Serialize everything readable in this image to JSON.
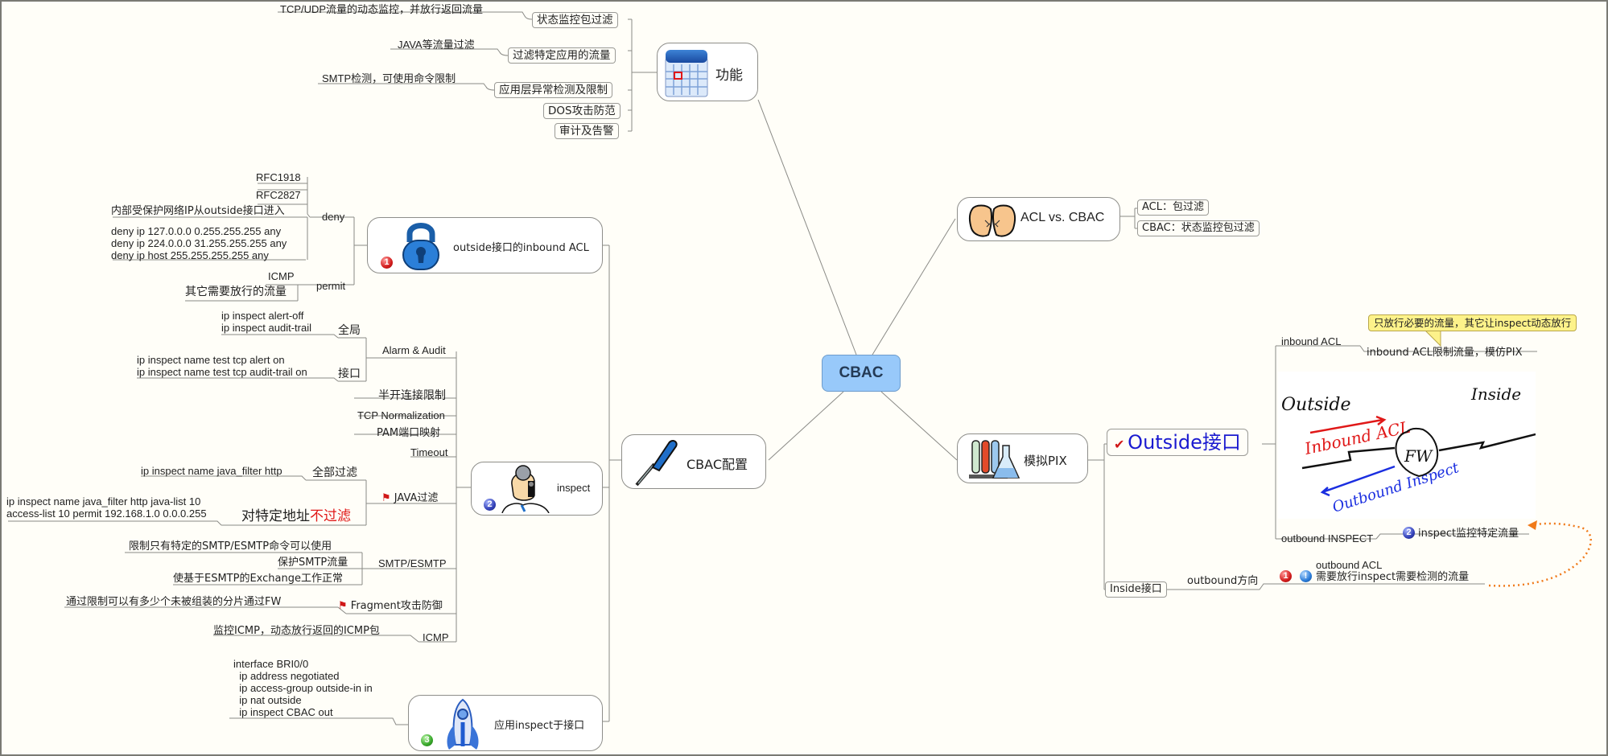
{
  "root": {
    "label": "CBAC"
  },
  "colors": {
    "root_fill": "#98c9fa",
    "accent_red": "#e01818",
    "outside_blue": "#1a1ad0",
    "dotted_arrow": "#f07a1a",
    "callout_fill": "#fdf28a"
  },
  "functions": {
    "label": "功能",
    "icon": "calendar-icon",
    "items": [
      {
        "label": "状态监控包过滤",
        "note": "TCP/UDP流量的动态监控，并放行返回流量"
      },
      {
        "label": "过滤特定应用的流量",
        "note": "JAVA等流量过滤"
      },
      {
        "label": "应用层异常检测及限制",
        "note": "SMTP检测，可使用命令限制"
      },
      {
        "label": "DOS攻击防范"
      },
      {
        "label": "审计及告警"
      }
    ]
  },
  "acl_vs_cbac": {
    "label": "ACL vs. CBAC",
    "icon": "fists-icon",
    "items": [
      "ACL：包过滤",
      "CBAC：状态监控包过滤"
    ]
  },
  "pix": {
    "label": "模拟PIX",
    "icon": "lab-flask-icon",
    "outside": {
      "label": "Outside接口",
      "inbound_acl": "inbound ACL",
      "inbound_acl_note": "inbound ACL限制流量，模仿PIX",
      "callout": "只放行必要的流量，其它让inspect动态放行",
      "drawing": {
        "outside": "Outside",
        "inside": "Inside",
        "inbound": "Inbound ACL",
        "fw": "FW",
        "outbound": "Outbound Inspect"
      },
      "outbound_inspect": "outbound INSPECT",
      "outbound_inspect_badge": "2",
      "outbound_inspect_note": "inspect监控特定流量"
    },
    "inside": {
      "label": "Inside接口",
      "direction": "outbound方向",
      "badge": "1",
      "note_title": "outbound ACL",
      "note_body": "需要放行inspect需要检测的流量"
    }
  },
  "config": {
    "label": "CBAC配置",
    "icon": "screwdriver-icon",
    "inbound_acl": {
      "label": "outside接口的inbound ACL",
      "badge": "1",
      "icon": "lock-icon",
      "deny": {
        "label": "deny",
        "items": [
          "RFC1918",
          "RFC2827",
          "内部受保护网络IP从outside接口进入"
        ],
        "commands": [
          "deny ip 127.0.0.0 0.255.255.255 any",
          "deny ip 224.0.0.0 31.255.255.255 any",
          "deny ip host 255.255.255.255 any"
        ]
      },
      "permit": {
        "label": "permit",
        "items": [
          "ICMP",
          "其它需要放行的流量"
        ]
      }
    },
    "inspect": {
      "label": "inspect",
      "badge": "2",
      "icon": "inspector-icon",
      "alarm_audit": {
        "label": "Alarm & Audit",
        "global": {
          "label": "全局",
          "commands": [
            "ip inspect alert-off",
            "ip inspect audit-trail"
          ]
        },
        "interface": {
          "label": "接口",
          "commands": [
            "ip inspect name test tcp alert on",
            "ip inspect name test tcp audit-trail on"
          ]
        }
      },
      "half_open": "半开连接限制",
      "tcp_norm": "TCP Normalization",
      "pam": "PAM端口映射",
      "timeout": "Timeout",
      "java": {
        "label": "JAVA过滤",
        "all": {
          "label": "全部过滤",
          "command": "ip inspect name java_filter http"
        },
        "specific": {
          "label_a": "对特定地址",
          "label_b": "不过滤",
          "commands": [
            "ip inspect name java_filter http java-list 10",
            "access-list 10 permit  192.168.1.0 0.0.0.255"
          ]
        }
      },
      "smtp": {
        "label": "SMTP/ESMTP",
        "items": [
          "限制只有特定的SMTP/ESMTP命令可以使用",
          "保护SMTP流量",
          "使基于ESMTP的Exchange工作正常"
        ]
      },
      "fragment": {
        "label": "Fragment攻击防御",
        "note": "通过限制可以有多少个未被组装的分片通过FW"
      },
      "icmp": {
        "label": "ICMP",
        "note": "监控ICMP，动态放行返回的ICMP包"
      }
    },
    "apply": {
      "label": "应用inspect于接口",
      "badge": "3",
      "icon": "rocket-icon",
      "commands": [
        "interface BRI0/0",
        "  ip address negotiated",
        "  ip access-group outside-in in",
        "  ip nat outside",
        "  ip inspect CBAC out"
      ]
    }
  }
}
